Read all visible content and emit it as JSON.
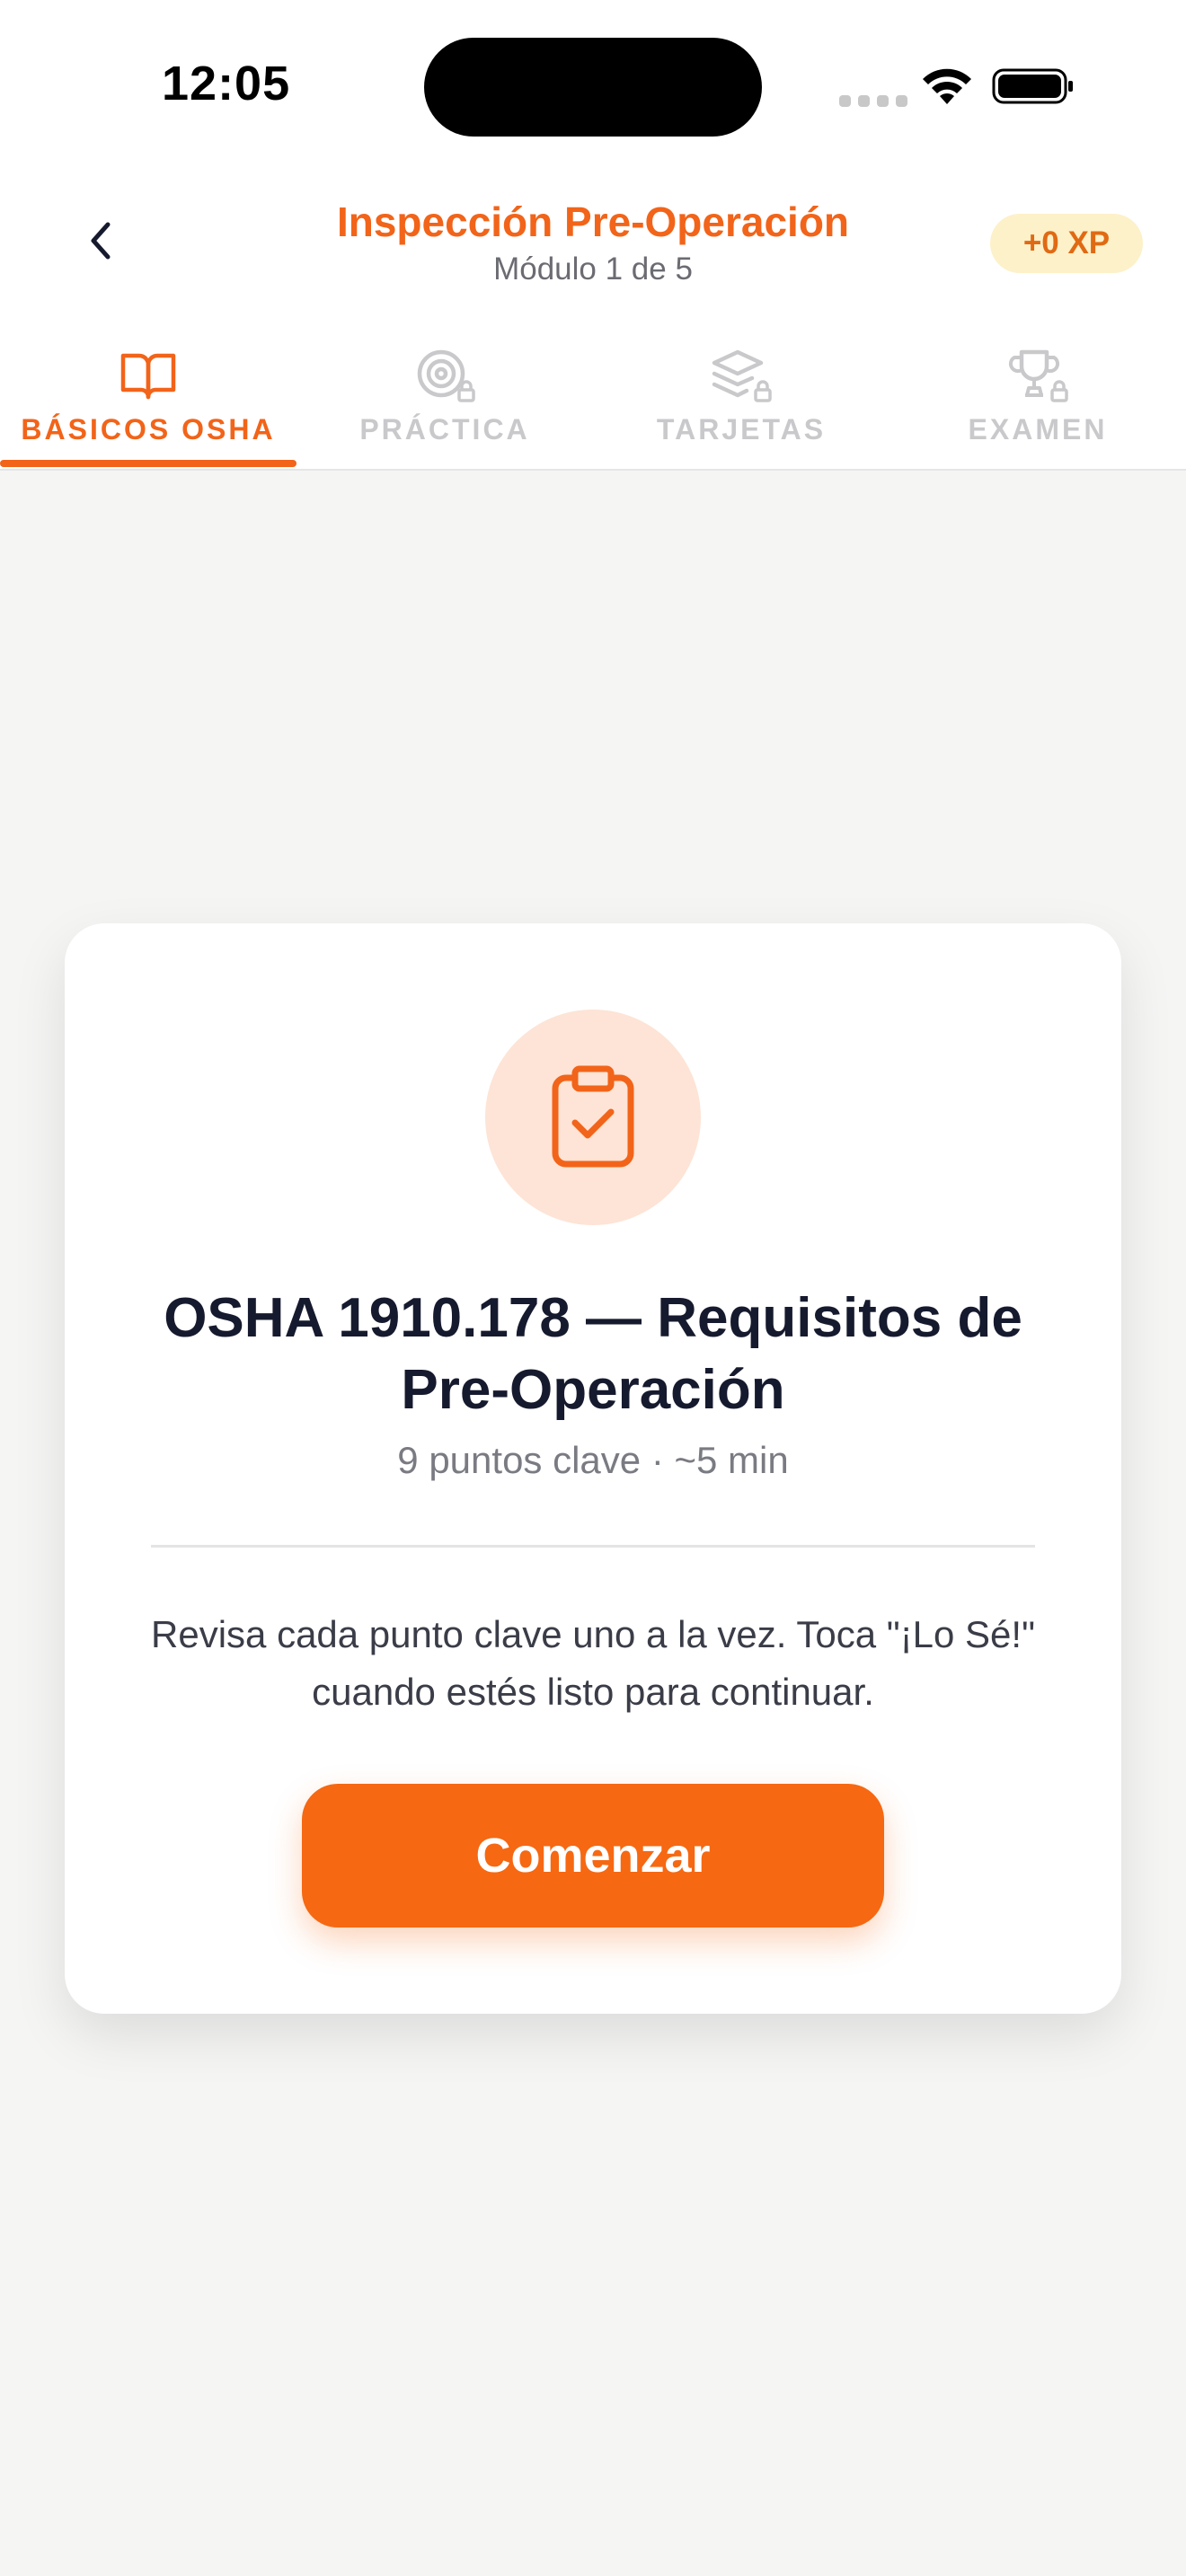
{
  "status_bar": {
    "time": "12:05"
  },
  "header": {
    "title": "Inspección Pre-Operación",
    "subtitle": "Módulo 1 de 5",
    "xp_badge": "+0 XP"
  },
  "tabs": [
    {
      "label": "BÁSICOS OSHA",
      "icon": "book-open-icon",
      "active": true,
      "locked": false
    },
    {
      "label": "PRÁCTICA",
      "icon": "target-icon",
      "active": false,
      "locked": true
    },
    {
      "label": "TARJETAS",
      "icon": "layers-icon",
      "active": false,
      "locked": true
    },
    {
      "label": "EXAMEN",
      "icon": "trophy-icon",
      "active": false,
      "locked": true
    }
  ],
  "card": {
    "icon": "clipboard-check-icon",
    "title": "OSHA 1910.178 — Requisitos de Pre-Operación",
    "meta": "9 puntos clave · ~5 min",
    "description": "Revisa cada punto clave uno a la vez. Toca \"¡Lo Sé!\" cuando estés listo para continuar.",
    "button_label": "Comenzar"
  },
  "colors": {
    "accent": "#f26419",
    "button": "#f66812",
    "xp_badge_bg": "#fdf1c9",
    "icon_circle_bg": "#fde4d6",
    "background": "#f5f5f4"
  }
}
